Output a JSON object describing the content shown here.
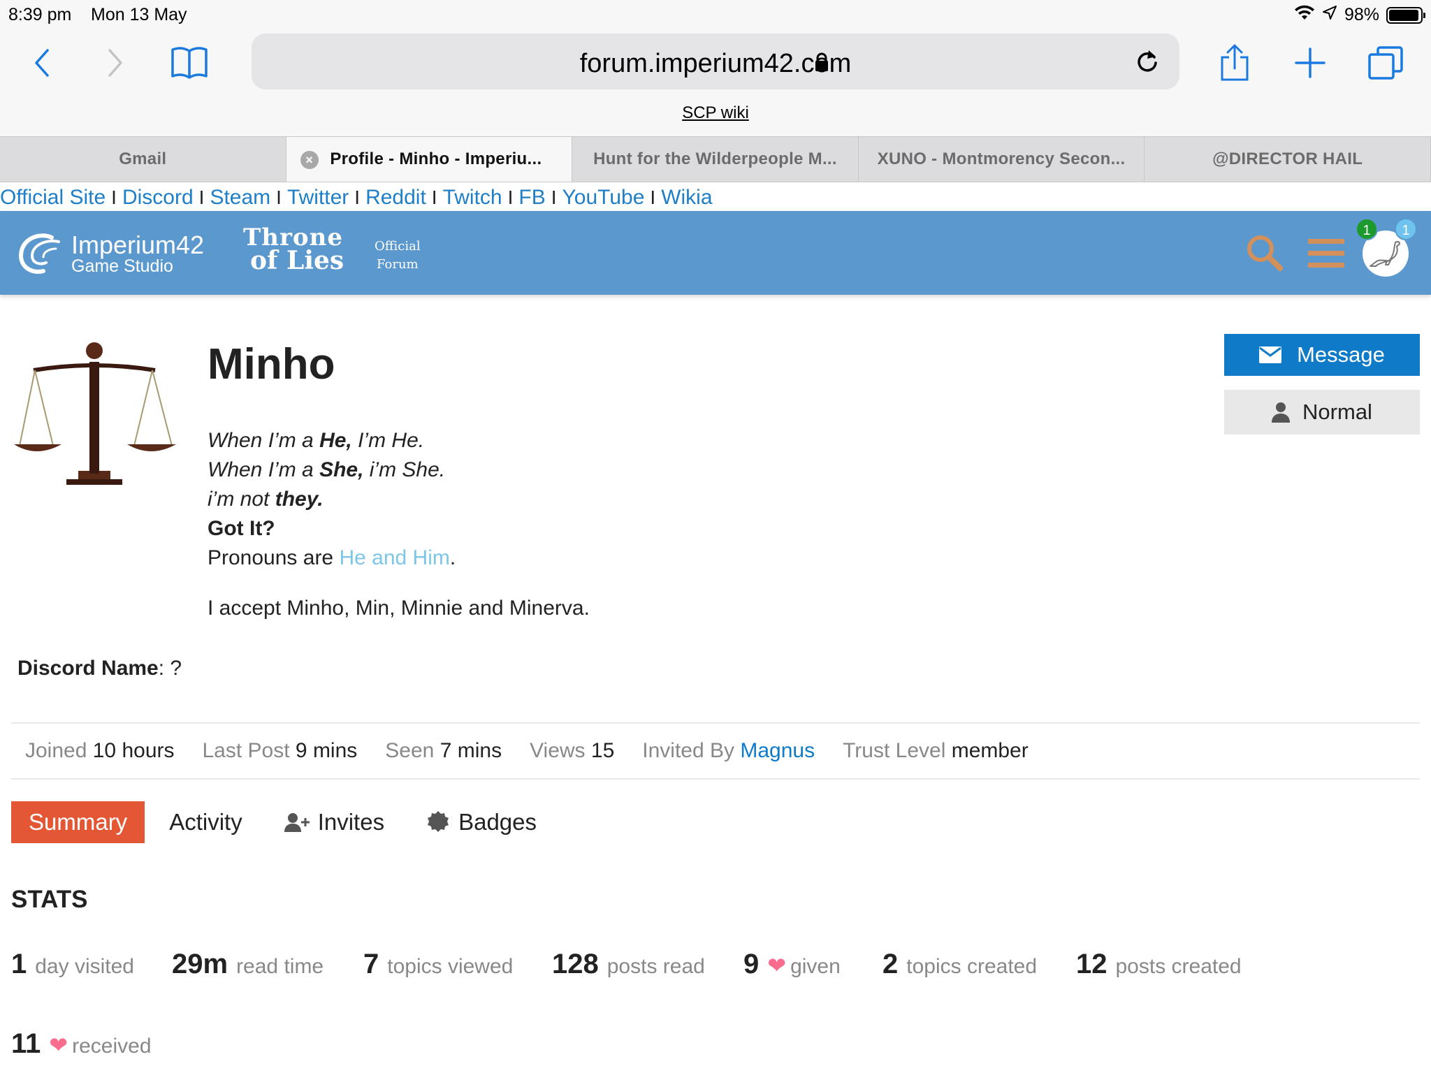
{
  "status_bar": {
    "time": "8:39 pm",
    "date": "Mon 13 May",
    "battery": "98%"
  },
  "browser": {
    "url": "forum.imperium42.com",
    "favorites_link": "SCP wiki",
    "tabs": [
      {
        "label": "Gmail",
        "active": false
      },
      {
        "label": "Profile - Minho - Imperiu...",
        "active": true
      },
      {
        "label": "Hunt for the Wilderpeople M...",
        "active": false
      },
      {
        "label": "XUNO - Montmorency Secon...",
        "active": false
      },
      {
        "label": "@DIRECTOR HAIL",
        "active": false
      }
    ]
  },
  "links_bar": [
    "Official Site",
    "Discord",
    "Steam",
    "Twitter",
    "Reddit",
    "Twitch",
    "FB",
    "YouTube",
    "Wikia"
  ],
  "links_sep": "I",
  "header": {
    "studio_line1": "Imperium42",
    "studio_line2": "Game Studio",
    "game_line1": "Throne",
    "game_line2": "of Lies",
    "official_line1": "Official",
    "official_line2": "Forum",
    "notifications_green": "1",
    "notifications_blue": "1"
  },
  "profile": {
    "name": "Minho",
    "bio_line1_pre": "When I’m a ",
    "bio_line1_bold": "He,",
    "bio_line1_post": " I’m He.",
    "bio_line2_pre": "When I’m a ",
    "bio_line2_bold": "She,",
    "bio_line2_post": " i’m She.",
    "bio_line3_pre": "i’m not ",
    "bio_line3_bold": "they.",
    "bio_line4": "Got It?",
    "pronouns_pre": "Pronouns are ",
    "pronouns_link": "He and Him",
    "pronouns_post": ".",
    "accept": "I accept Minho, Min, Minnie and Minerva.",
    "discord_label": "Discord Name",
    "discord_value": ": ?"
  },
  "buttons": {
    "message": "Message",
    "normal": "Normal"
  },
  "meta": {
    "joined_label": "Joined",
    "joined": "10 hours",
    "last_post_label": "Last Post",
    "last_post": "9 mins",
    "seen_label": "Seen",
    "seen": "7 mins",
    "views_label": "Views",
    "views": "15",
    "invited_label": "Invited By",
    "invited_by": "Magnus",
    "trust_label": "Trust Level",
    "trust": "member"
  },
  "nav": {
    "summary": "Summary",
    "activity": "Activity",
    "invites": "Invites",
    "badges": "Badges"
  },
  "stats": {
    "title": "STATS",
    "days_visited": {
      "num": "1",
      "label": "day visited"
    },
    "read_time": {
      "num": "29m",
      "label": "read time"
    },
    "topics_viewed": {
      "num": "7",
      "label": "topics viewed"
    },
    "posts_read": {
      "num": "128",
      "label": "posts read"
    },
    "likes_given": {
      "num": "9",
      "label": "given"
    },
    "topics_created": {
      "num": "2",
      "label": "topics created"
    },
    "posts_created": {
      "num": "12",
      "label": "posts created"
    },
    "likes_received": {
      "num": "11",
      "label": "received"
    }
  },
  "colors": {
    "header_bg": "#5b98cd",
    "primary": "#0f7bc8",
    "summary_tab": "#e45735",
    "heart": "#fa6c8d"
  }
}
